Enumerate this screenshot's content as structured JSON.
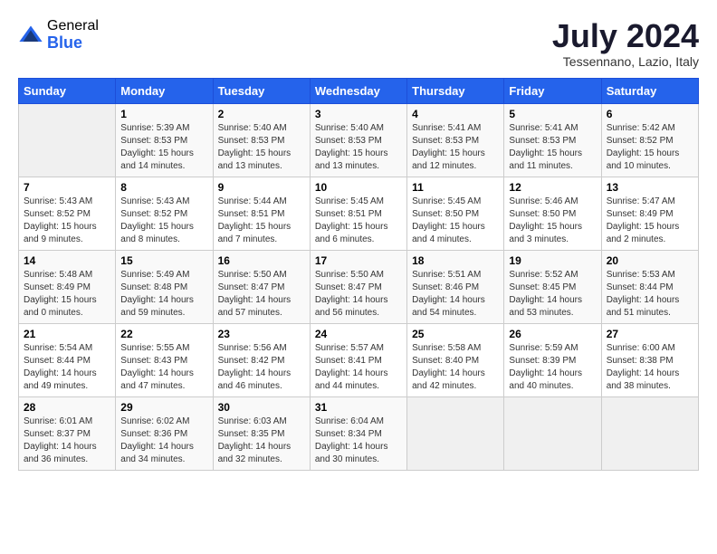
{
  "logo": {
    "general": "General",
    "blue": "Blue"
  },
  "title": "July 2024",
  "location": "Tessennano, Lazio, Italy",
  "weekdays": [
    "Sunday",
    "Monday",
    "Tuesday",
    "Wednesday",
    "Thursday",
    "Friday",
    "Saturday"
  ],
  "weeks": [
    [
      {
        "day": "",
        "sunrise": "",
        "sunset": "",
        "daylight": ""
      },
      {
        "day": "1",
        "sunrise": "5:39 AM",
        "sunset": "8:53 PM",
        "daylight": "15 hours and 14 minutes."
      },
      {
        "day": "2",
        "sunrise": "5:40 AM",
        "sunset": "8:53 PM",
        "daylight": "15 hours and 13 minutes."
      },
      {
        "day": "3",
        "sunrise": "5:40 AM",
        "sunset": "8:53 PM",
        "daylight": "15 hours and 13 minutes."
      },
      {
        "day": "4",
        "sunrise": "5:41 AM",
        "sunset": "8:53 PM",
        "daylight": "15 hours and 12 minutes."
      },
      {
        "day": "5",
        "sunrise": "5:41 AM",
        "sunset": "8:53 PM",
        "daylight": "15 hours and 11 minutes."
      },
      {
        "day": "6",
        "sunrise": "5:42 AM",
        "sunset": "8:52 PM",
        "daylight": "15 hours and 10 minutes."
      }
    ],
    [
      {
        "day": "7",
        "sunrise": "5:43 AM",
        "sunset": "8:52 PM",
        "daylight": "15 hours and 9 minutes."
      },
      {
        "day": "8",
        "sunrise": "5:43 AM",
        "sunset": "8:52 PM",
        "daylight": "15 hours and 8 minutes."
      },
      {
        "day": "9",
        "sunrise": "5:44 AM",
        "sunset": "8:51 PM",
        "daylight": "15 hours and 7 minutes."
      },
      {
        "day": "10",
        "sunrise": "5:45 AM",
        "sunset": "8:51 PM",
        "daylight": "15 hours and 6 minutes."
      },
      {
        "day": "11",
        "sunrise": "5:45 AM",
        "sunset": "8:50 PM",
        "daylight": "15 hours and 4 minutes."
      },
      {
        "day": "12",
        "sunrise": "5:46 AM",
        "sunset": "8:50 PM",
        "daylight": "15 hours and 3 minutes."
      },
      {
        "day": "13",
        "sunrise": "5:47 AM",
        "sunset": "8:49 PM",
        "daylight": "15 hours and 2 minutes."
      }
    ],
    [
      {
        "day": "14",
        "sunrise": "5:48 AM",
        "sunset": "8:49 PM",
        "daylight": "15 hours and 0 minutes."
      },
      {
        "day": "15",
        "sunrise": "5:49 AM",
        "sunset": "8:48 PM",
        "daylight": "14 hours and 59 minutes."
      },
      {
        "day": "16",
        "sunrise": "5:50 AM",
        "sunset": "8:47 PM",
        "daylight": "14 hours and 57 minutes."
      },
      {
        "day": "17",
        "sunrise": "5:50 AM",
        "sunset": "8:47 PM",
        "daylight": "14 hours and 56 minutes."
      },
      {
        "day": "18",
        "sunrise": "5:51 AM",
        "sunset": "8:46 PM",
        "daylight": "14 hours and 54 minutes."
      },
      {
        "day": "19",
        "sunrise": "5:52 AM",
        "sunset": "8:45 PM",
        "daylight": "14 hours and 53 minutes."
      },
      {
        "day": "20",
        "sunrise": "5:53 AM",
        "sunset": "8:44 PM",
        "daylight": "14 hours and 51 minutes."
      }
    ],
    [
      {
        "day": "21",
        "sunrise": "5:54 AM",
        "sunset": "8:44 PM",
        "daylight": "14 hours and 49 minutes."
      },
      {
        "day": "22",
        "sunrise": "5:55 AM",
        "sunset": "8:43 PM",
        "daylight": "14 hours and 47 minutes."
      },
      {
        "day": "23",
        "sunrise": "5:56 AM",
        "sunset": "8:42 PM",
        "daylight": "14 hours and 46 minutes."
      },
      {
        "day": "24",
        "sunrise": "5:57 AM",
        "sunset": "8:41 PM",
        "daylight": "14 hours and 44 minutes."
      },
      {
        "day": "25",
        "sunrise": "5:58 AM",
        "sunset": "8:40 PM",
        "daylight": "14 hours and 42 minutes."
      },
      {
        "day": "26",
        "sunrise": "5:59 AM",
        "sunset": "8:39 PM",
        "daylight": "14 hours and 40 minutes."
      },
      {
        "day": "27",
        "sunrise": "6:00 AM",
        "sunset": "8:38 PM",
        "daylight": "14 hours and 38 minutes."
      }
    ],
    [
      {
        "day": "28",
        "sunrise": "6:01 AM",
        "sunset": "8:37 PM",
        "daylight": "14 hours and 36 minutes."
      },
      {
        "day": "29",
        "sunrise": "6:02 AM",
        "sunset": "8:36 PM",
        "daylight": "14 hours and 34 minutes."
      },
      {
        "day": "30",
        "sunrise": "6:03 AM",
        "sunset": "8:35 PM",
        "daylight": "14 hours and 32 minutes."
      },
      {
        "day": "31",
        "sunrise": "6:04 AM",
        "sunset": "8:34 PM",
        "daylight": "14 hours and 30 minutes."
      },
      {
        "day": "",
        "sunrise": "",
        "sunset": "",
        "daylight": ""
      },
      {
        "day": "",
        "sunrise": "",
        "sunset": "",
        "daylight": ""
      },
      {
        "day": "",
        "sunrise": "",
        "sunset": "",
        "daylight": ""
      }
    ]
  ]
}
